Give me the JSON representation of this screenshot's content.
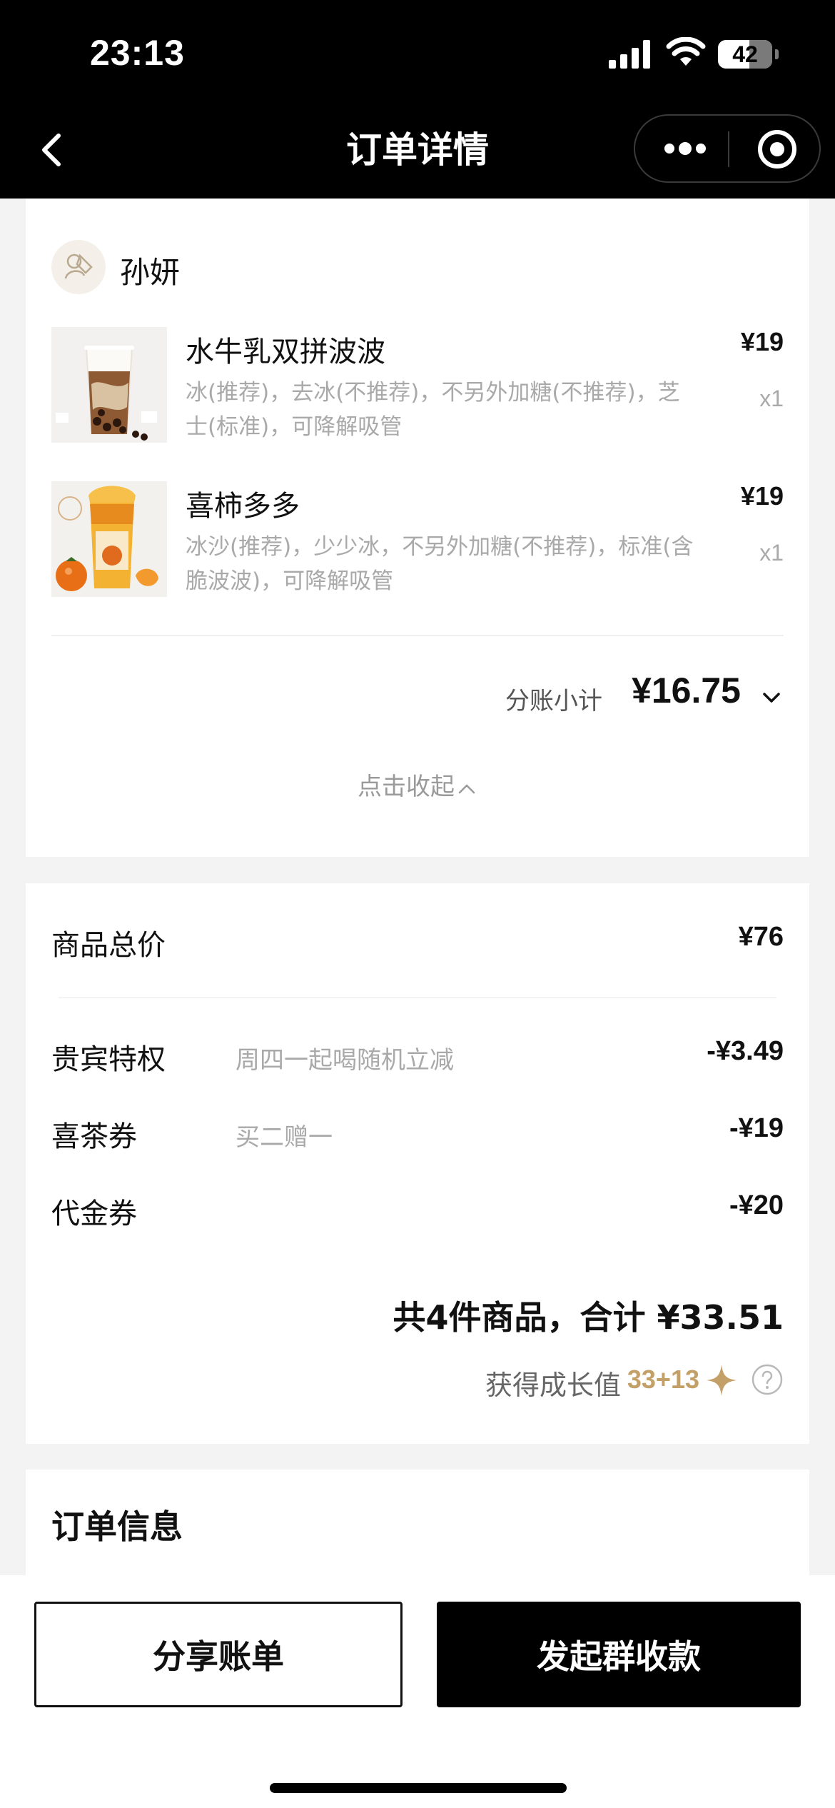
{
  "status_bar": {
    "time": "23:13",
    "battery": "42",
    "battery_level": 0.58
  },
  "nav": {
    "title": "订单详情",
    "icons": [
      "back-icon",
      "more-icon",
      "target-icon"
    ]
  },
  "user": {
    "name": "孙妍",
    "avatar_icon": "user-avatar-icon"
  },
  "items": [
    {
      "name": "水牛乳双拼波波",
      "desc": "冰(推荐)，去冰(不推荐)，不另外加糖(不推荐)，芝士(标准)，可降解吸管",
      "price": "¥19",
      "qty": "x1"
    },
    {
      "name": "喜柿多多",
      "desc": "冰沙(推荐)，少少冰，不另外加糖(不推荐)，标准(含脆波波)，可降解吸管",
      "price": "¥19",
      "qty": "x1"
    }
  ],
  "subtotal": {
    "label": "分账小计",
    "value": "¥16.75"
  },
  "collapse_label": "点击收起",
  "totals": {
    "goods_label": "商品总价",
    "goods_value": "¥76",
    "vip_label": "贵宾特权",
    "vip_note": "周四一起喝随机立减",
    "vip_value": "-¥3.49",
    "coupon_label": "喜茶券",
    "coupon_note": "买二赠一",
    "coupon_value": "-¥19",
    "voucher_label": "代金券",
    "voucher_value": "-¥20",
    "grand_total": "共4件商品，合计 ¥33.51",
    "growth_label": "获得成长值",
    "growth_value": "33+13"
  },
  "order_info": {
    "title": "订单信息"
  },
  "actions": {
    "share_label": "分享账单",
    "collect_label": "发起群收款"
  },
  "colors": {
    "accent_gold": "#c3a068",
    "primary": "#000000",
    "background": "#f3f3f3"
  }
}
